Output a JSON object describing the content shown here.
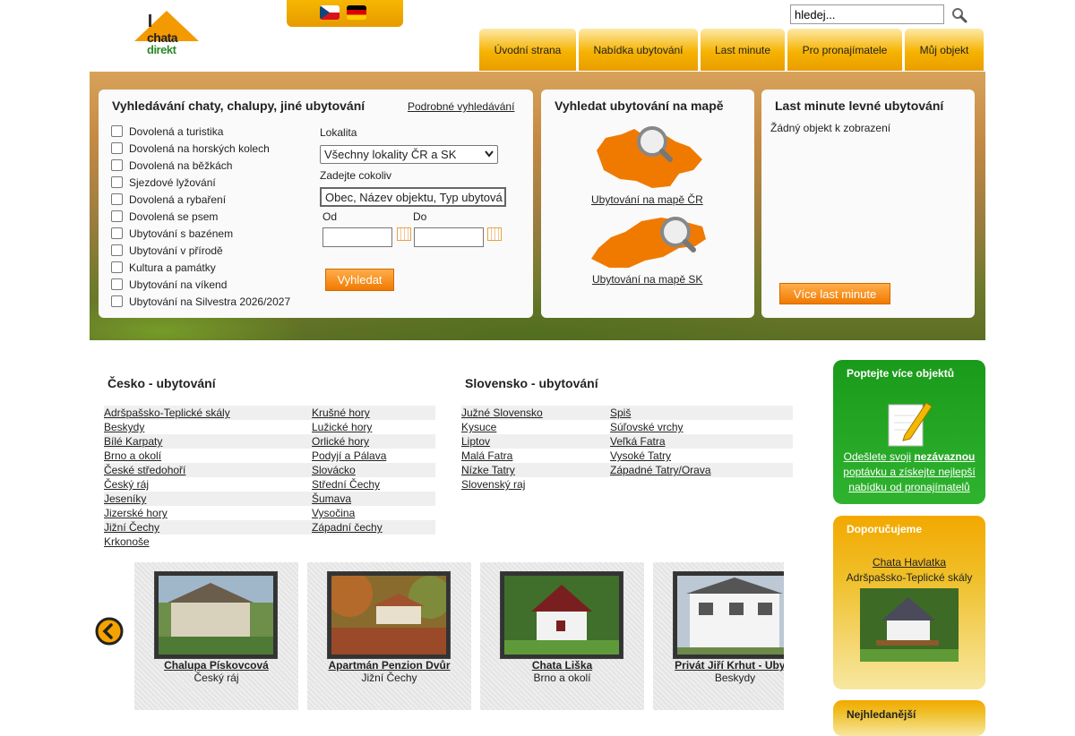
{
  "header": {
    "search_value": "hledej...",
    "logo_text_top": "chata",
    "logo_text_bottom": "direkt",
    "languages": [
      "cz-flag",
      "de-flag"
    ]
  },
  "nav": [
    {
      "label": "Úvodní strana"
    },
    {
      "label": "Nabídka ubytování"
    },
    {
      "label": "Last minute"
    },
    {
      "label": "Pro pronajímatele"
    },
    {
      "label": "Můj objekt"
    }
  ],
  "search_panel": {
    "title": "Vyhledávání chaty, chalupy, jiné ubytování",
    "advanced_link": "Podrobné vyhledávání",
    "categories": [
      "Dovolená a turistika",
      "Dovolená na horských kolech",
      "Dovolená na běžkách",
      "Sjezdové lyžování",
      "Dovolená a rybaření",
      "Dovolená se psem",
      "Ubytování s bazénem",
      "Ubytování v přírodě",
      "Kultura a památky",
      "Ubytování na víkend",
      "Ubytování na Silvestra 2026/2027"
    ],
    "locality_label": "Lokalita",
    "locality_value": "Všechny lokality ČR a SK",
    "query_label": "Zadejte cokoliv",
    "query_value": "Obec, Název objektu, Typ ubytová",
    "from_label": "Od",
    "to_label": "Do",
    "submit_label": "Vyhledat"
  },
  "map_panel": {
    "title": "Vyhledat ubytování na mapě",
    "cz_link": "Ubytování na mapě ČR",
    "sk_link": "Ubytování na mapě SK"
  },
  "lastminute_panel": {
    "title": "Last minute levné ubytování",
    "empty_text": "Žádný objekt k zobrazení",
    "more_label": "Více last minute"
  },
  "cz_regions": {
    "title": "Česko - ubytování",
    "col1": [
      "Adršpašsko-Teplické skály",
      "Beskydy",
      "Bílé Karpaty",
      "Brno a okolí",
      "České středohoří",
      "Český ráj",
      "Jeseníky",
      "Jizerské hory",
      "Jižní Čechy",
      "Krkonoše"
    ],
    "col2": [
      "Krušné hory",
      "Lužické hory",
      "Orlické hory",
      "Podyjí a Pálava",
      "Slovácko",
      "Střední Čechy",
      "Šumava",
      "Vysočina",
      "Západní čechy"
    ]
  },
  "sk_regions": {
    "title": "Slovensko - ubytování",
    "col1": [
      "Južné Slovensko",
      "Kysuce",
      "Liptov",
      "Malá Fatra",
      "Nízke Tatry",
      "Slovenský raj"
    ],
    "col2": [
      "Spiš",
      "Súľovské vrchy",
      "Veľká Fatra",
      "Vysoké Tatry",
      "Západné Tatry/Orava"
    ]
  },
  "carousel": [
    {
      "name": "Chalupa Pískovcová",
      "region": "Český ráj"
    },
    {
      "name": "Apartmán Penzion Dvůr",
      "region": "Jižní Čechy"
    },
    {
      "name": "Chata Liška",
      "region": "Brno a okolí"
    },
    {
      "name": "Privát Jiří Krhut - Ubyto",
      "region": "Beskydy"
    }
  ],
  "sidebar": {
    "inquiry_title": "Poptejte více objektů",
    "inquiry_text_1": "Odešlete svoji",
    "inquiry_text_bold": "nezávaznou",
    "inquiry_text_2": "poptávku a získejte nejlepší nabídku od pronajímatelů",
    "recommend_title": "Doporučujeme",
    "recommend_name": "Chata Havlatka",
    "recommend_region": "Adršpašsko-Teplické skály",
    "most_searched_title": "Nejhledanější"
  },
  "colors": {
    "accent": "#f07a00",
    "nav": "#f6b300",
    "map": "#f07a00"
  }
}
